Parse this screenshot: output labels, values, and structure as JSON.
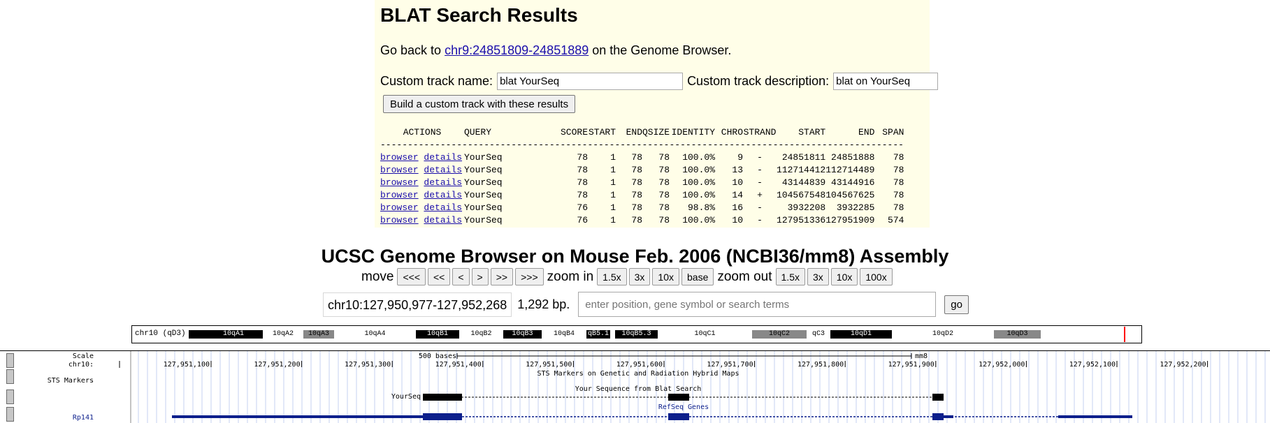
{
  "blat": {
    "title": "BLAT Search Results",
    "goback_prefix": "Go back to ",
    "goback_link": "chr9:24851809-24851889",
    "goback_suffix": " on the Genome Browser.",
    "ct_name_label": "Custom track name:",
    "ct_name_value": "blat YourSeq",
    "ct_desc_label": "Custom track description:",
    "ct_desc_value": "blat on YourSeq",
    "build_button": "Build a custom track with these results",
    "headers": [
      "ACTIONS",
      "QUERY",
      "SCORE",
      "START",
      "END",
      "QSIZE",
      "IDENTITY",
      "CHRO",
      "STRAND",
      "START",
      "END",
      "SPAN"
    ],
    "divider": "---------------------------------------------------------------------------------------------------------------",
    "rows": [
      {
        "a1": "browser",
        "a2": "details",
        "query": "YourSeq",
        "score": "78",
        "start": "1",
        "end": "78",
        "qsize": "78",
        "identity": "100.0%",
        "chro": "9",
        "strand": "-",
        "tstart": "24851811",
        "tend": "24851888",
        "span": "78"
      },
      {
        "a1": "browser",
        "a2": "details",
        "query": "YourSeq",
        "score": "78",
        "start": "1",
        "end": "78",
        "qsize": "78",
        "identity": "100.0%",
        "chro": "13",
        "strand": "-",
        "tstart": "112714412",
        "tend": "112714489",
        "span": "78"
      },
      {
        "a1": "browser",
        "a2": "details",
        "query": "YourSeq",
        "score": "78",
        "start": "1",
        "end": "78",
        "qsize": "78",
        "identity": "100.0%",
        "chro": "10",
        "strand": "-",
        "tstart": "43144839",
        "tend": "43144916",
        "span": "78"
      },
      {
        "a1": "browser",
        "a2": "details",
        "query": "YourSeq",
        "score": "78",
        "start": "1",
        "end": "78",
        "qsize": "78",
        "identity": "100.0%",
        "chro": "14",
        "strand": "+",
        "tstart": "104567548",
        "tend": "104567625",
        "span": "78"
      },
      {
        "a1": "browser",
        "a2": "details",
        "query": "YourSeq",
        "score": "76",
        "start": "1",
        "end": "78",
        "qsize": "78",
        "identity": "98.8%",
        "chro": "16",
        "strand": "-",
        "tstart": "3932208",
        "tend": "3932285",
        "span": "78"
      },
      {
        "a1": "browser",
        "a2": "details",
        "query": "YourSeq",
        "score": "76",
        "start": "1",
        "end": "78",
        "qsize": "78",
        "identity": "100.0%",
        "chro": "10",
        "strand": "-",
        "tstart": "127951336",
        "tend": "127951909",
        "span": "574"
      }
    ]
  },
  "browser": {
    "title": "UCSC Genome Browser on Mouse Feb. 2006 (NCBI36/mm8) Assembly",
    "move_label": "move",
    "move_buttons": [
      "<<<",
      "<<",
      "<",
      ">",
      ">>",
      ">>>"
    ],
    "zoomin_label": "zoom in",
    "zoomin_buttons": [
      "1.5x",
      "3x",
      "10x",
      "base"
    ],
    "zoomout_label": "zoom out",
    "zoomout_buttons": [
      "1.5x",
      "3x",
      "10x",
      "100x"
    ],
    "position": "chr10:127,950,977-127,952,268",
    "bp": "1,292 bp.",
    "search_placeholder": "enter position, gene symbol or search terms",
    "go_button": "go"
  },
  "ideogram": {
    "label": "chr10 (qD3)",
    "bands": [
      {
        "name": "",
        "shade": "#000000"
      },
      {
        "name": "10qA1",
        "shade": "#000000"
      },
      {
        "name": "10qA2",
        "shade": "#ffffff"
      },
      {
        "name": "10qA3",
        "shade": "#888888"
      },
      {
        "name": "10qA4",
        "shade": "#ffffff"
      },
      {
        "name": "10qB1",
        "shade": "#000000"
      },
      {
        "name": "10qB2",
        "shade": "#ffffff"
      },
      {
        "name": "10qB3",
        "shade": "#000000"
      },
      {
        "name": "10qB4",
        "shade": "#ffffff"
      },
      {
        "name": "qB5.1",
        "shade": "#000000"
      },
      {
        "name": "",
        "shade": "#ffffff"
      },
      {
        "name": "10qB5.3",
        "shade": "#000000"
      },
      {
        "name": "10qC1",
        "shade": "#ffffff"
      },
      {
        "name": "10qC2",
        "shade": "#888888"
      },
      {
        "name": "qC3",
        "shade": "#ffffff"
      },
      {
        "name": "10qD1",
        "shade": "#000000"
      },
      {
        "name": "10qD2",
        "shade": "#ffffff"
      },
      {
        "name": "10qD3",
        "shade": "#888888"
      }
    ],
    "highlight_color": "#ff0000"
  },
  "tracks": {
    "side_labels": [
      "Scale",
      "chr10:",
      "STS Markers",
      "Rp141"
    ],
    "scale_text": "500 bases",
    "scale_assembly": "mm8",
    "coords": [
      "127,951,100",
      "127,951,200",
      "127,951,300",
      "127,951,400",
      "127,951,500",
      "127,951,600",
      "127,951,700",
      "127,951,800",
      "127,951,900",
      "127,952,000",
      "127,952,100",
      "127,952,200"
    ],
    "sts_title": "STS Markers on Genetic and Radiation Hybrid Maps",
    "blat_title": "Your Sequence from Blat Search",
    "blat_item": "YourSeq",
    "refseq_title": "RefSeq Genes",
    "colors": {
      "blat": "#000000",
      "refseq": "#0c1f8c",
      "label_blue": "#0c1f8c",
      "grid": "#c6d2f0"
    }
  }
}
